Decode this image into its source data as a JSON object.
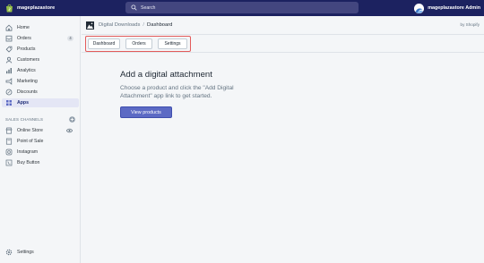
{
  "topbar": {
    "store_name": "mageplazastore",
    "search_placeholder": "Search",
    "admin_name": "mageplazastore Admin"
  },
  "sidebar": {
    "items": [
      {
        "label": "Home",
        "icon": "home-icon"
      },
      {
        "label": "Orders",
        "icon": "orders-icon",
        "badge": "4"
      },
      {
        "label": "Products",
        "icon": "products-icon"
      },
      {
        "label": "Customers",
        "icon": "customers-icon"
      },
      {
        "label": "Analytics",
        "icon": "analytics-icon"
      },
      {
        "label": "Marketing",
        "icon": "marketing-icon"
      },
      {
        "label": "Discounts",
        "icon": "discounts-icon"
      },
      {
        "label": "Apps",
        "icon": "apps-icon",
        "active": true
      }
    ],
    "sales_channels_title": "SALES CHANNELS",
    "channels": [
      {
        "label": "Online Store",
        "icon": "online-store-icon"
      },
      {
        "label": "Point of Sale",
        "icon": "point-of-sale-icon"
      },
      {
        "label": "Instagram",
        "icon": "instagram-icon"
      },
      {
        "label": "Buy Button",
        "icon": "buy-button-icon"
      }
    ],
    "settings_label": "Settings"
  },
  "app": {
    "breadcrumb_parent": "Digital Downloads",
    "breadcrumb_separator": "/",
    "breadcrumb_current": "Dashboard",
    "by_label": "by Shopify",
    "tabs": [
      "Dashboard",
      "Orders",
      "Settings"
    ]
  },
  "main": {
    "title": "Add a digital attachment",
    "description": "Choose a product and click the \"Add Digital Attachment\" app link to get started.",
    "button_label": "View products"
  },
  "colors": {
    "topbar": "#1c2260",
    "primary": "#5c6ac4",
    "highlight": "#e35b5b",
    "active_nav": "#e4e6f5"
  }
}
